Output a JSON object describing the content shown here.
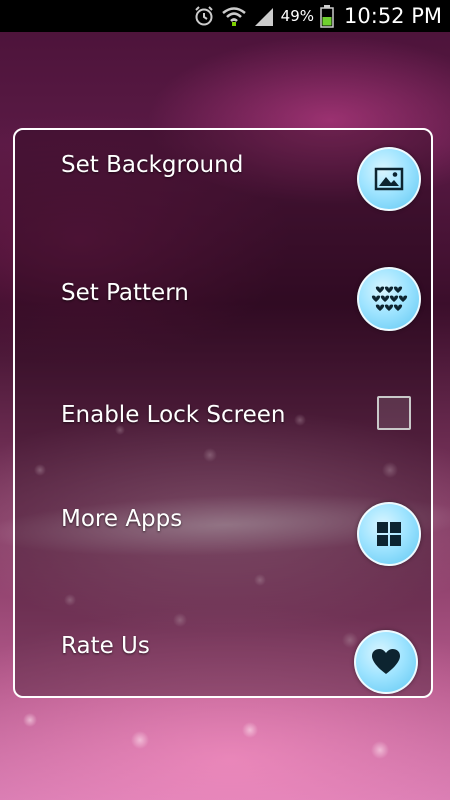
{
  "status_bar": {
    "battery_percent": "49%",
    "time": "10:52 PM",
    "icons": [
      "alarm-icon",
      "wifi-icon",
      "signal-icon",
      "battery-icon"
    ]
  },
  "menu": {
    "items": [
      {
        "label": "Set Background",
        "icon": "image-icon"
      },
      {
        "label": "Set Pattern",
        "icon": "hearts-pattern-icon"
      },
      {
        "label": "Enable Lock Screen",
        "control": "checkbox",
        "checked": false
      },
      {
        "label": "More Apps",
        "icon": "grid-icon"
      },
      {
        "label": "Rate Us",
        "icon": "heart-icon"
      }
    ]
  },
  "colors": {
    "icon_circle": "#9fe4ff",
    "panel_border": "#ffffff",
    "status_bar": "#000000"
  }
}
